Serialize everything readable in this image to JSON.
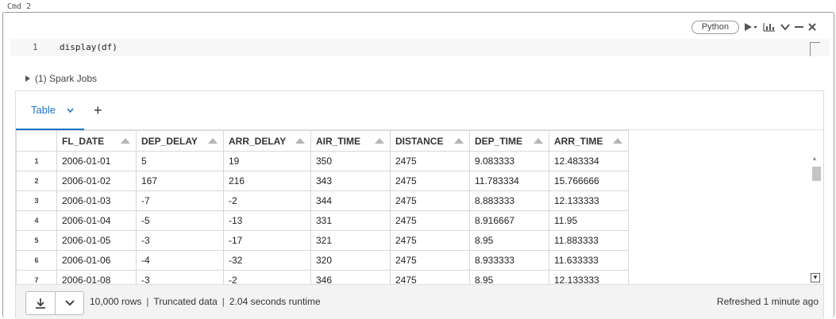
{
  "cell": {
    "label": "Cmd 2",
    "language": "Python",
    "line_number": "1",
    "code": "display(df)"
  },
  "spark_jobs": {
    "label": "(1) Spark Jobs"
  },
  "tabs": {
    "active_label": "Table",
    "add_label": "+"
  },
  "table": {
    "columns": [
      "FL_DATE",
      "DEP_DELAY",
      "ARR_DELAY",
      "AIR_TIME",
      "DISTANCE",
      "DEP_TIME",
      "ARR_TIME"
    ],
    "rows": [
      {
        "num": "1",
        "cells": [
          "2006-01-01",
          "5",
          "19",
          "350",
          "2475",
          "9.083333",
          "12.483334"
        ]
      },
      {
        "num": "2",
        "cells": [
          "2006-01-02",
          "167",
          "216",
          "343",
          "2475",
          "11.783334",
          "15.766666"
        ]
      },
      {
        "num": "3",
        "cells": [
          "2006-01-03",
          "-7",
          "-2",
          "344",
          "2475",
          "8.883333",
          "12.133333"
        ]
      },
      {
        "num": "4",
        "cells": [
          "2006-01-04",
          "-5",
          "-13",
          "331",
          "2475",
          "8.916667",
          "11.95"
        ]
      },
      {
        "num": "5",
        "cells": [
          "2006-01-05",
          "-3",
          "-17",
          "321",
          "2475",
          "8.95",
          "11.883333"
        ]
      },
      {
        "num": "6",
        "cells": [
          "2006-01-06",
          "-4",
          "-32",
          "320",
          "2475",
          "8.933333",
          "11.633333"
        ]
      },
      {
        "num": "7",
        "cells": [
          "2006-01-08",
          "-3",
          "-2",
          "346",
          "2475",
          "8.95",
          "12.133333"
        ]
      }
    ]
  },
  "footer": {
    "rows": "10,000 rows",
    "truncated": "Truncated data",
    "runtime": "2.04 seconds runtime",
    "separator": "|",
    "refreshed": "Refreshed 1 minute ago"
  },
  "icons": {
    "run": "run-icon",
    "chart": "chart-icon",
    "collapse": "chevron-down-icon",
    "minimize": "minimize-icon",
    "close": "close-icon",
    "download": "download-icon",
    "expand": "chevron-down-icon"
  },
  "colors": {
    "accent": "#1f73c8",
    "footer_bg": "#f3f3f3",
    "code_bg": "#f7f7f7"
  }
}
